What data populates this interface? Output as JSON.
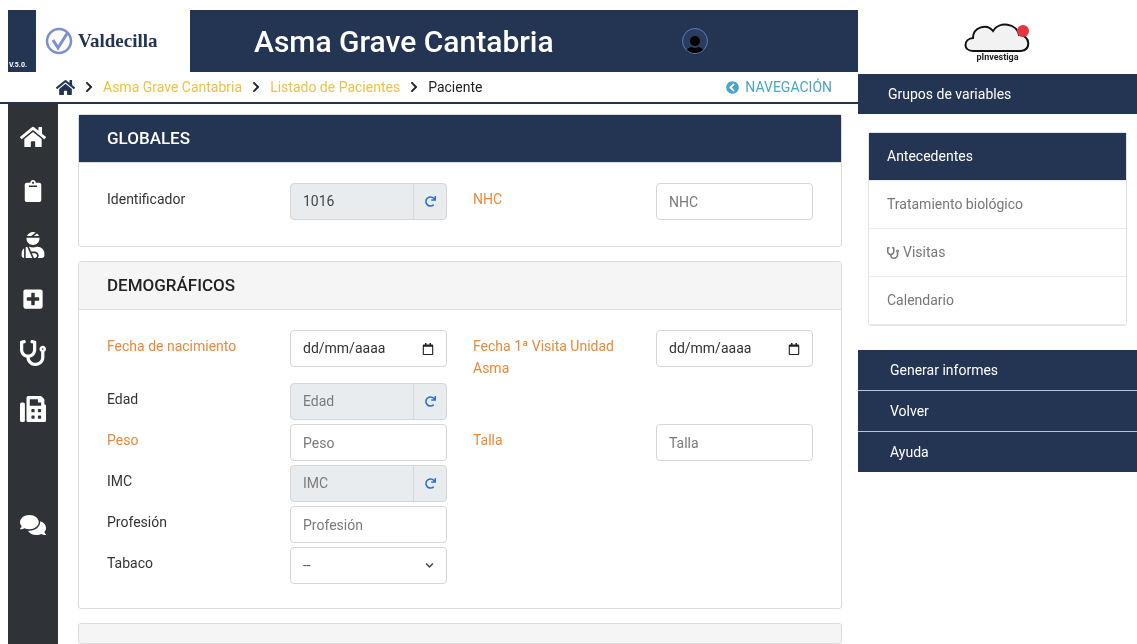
{
  "header": {
    "version": "V.5.0.",
    "logo_text": "Valdecilla",
    "title": "Asma Grave Cantabria",
    "brand_logo_text": "pInvestiga"
  },
  "breadcrumb": {
    "items": [
      {
        "label": "Asma Grave Cantabria",
        "kind": "link"
      },
      {
        "label": "Listado de Pacientes",
        "kind": "link"
      },
      {
        "label": "Paciente",
        "kind": "current"
      }
    ],
    "nav_button": "NAVEGACIÓN"
  },
  "sections": [
    {
      "title": "GLOBALES",
      "kind": "primary",
      "rows": [
        [
          {
            "label": "Identificador",
            "required": false,
            "kind": "computed",
            "value": "1016"
          },
          {
            "label": "NHC",
            "required": true,
            "kind": "text",
            "placeholder": "NHC"
          }
        ]
      ]
    },
    {
      "title": "DEMOGRÁFICOS",
      "kind": "secondary",
      "rows": [
        [
          {
            "label": "Fecha de nacimiento",
            "required": true,
            "kind": "date",
            "placeholder": "dd/mm/aaaa"
          },
          {
            "label": "Fecha 1ª Visita Unidad Asma",
            "required": true,
            "kind": "date",
            "placeholder": "dd/mm/aaaa"
          }
        ],
        [
          {
            "label": "Edad",
            "required": false,
            "kind": "computed",
            "placeholder": "Edad"
          }
        ],
        [
          {
            "label": "Peso",
            "required": true,
            "kind": "text",
            "placeholder": "Peso"
          },
          {
            "label": "Talla",
            "required": true,
            "kind": "text",
            "placeholder": "Talla"
          }
        ],
        [
          {
            "label": "IMC",
            "required": false,
            "kind": "computed",
            "placeholder": "IMC"
          }
        ],
        [
          {
            "label": "Profesión",
            "required": false,
            "kind": "text",
            "placeholder": "Profesión"
          }
        ],
        [
          {
            "label": "Tabaco",
            "required": false,
            "kind": "select",
            "value": "--"
          }
        ]
      ]
    }
  ],
  "side_panel": {
    "title": "Grupos de variables",
    "groups": [
      {
        "label": "Antecedentes",
        "selected": true,
        "kind": "text"
      },
      {
        "label": "Tratamiento biológico",
        "selected": false,
        "kind": "text"
      },
      {
        "label": "Visitas",
        "selected": false,
        "kind": "icon"
      },
      {
        "label": "Calendario",
        "selected": false,
        "kind": "text"
      }
    ],
    "actions": [
      "Generar informes",
      "Volver",
      "Ayuda"
    ]
  }
}
